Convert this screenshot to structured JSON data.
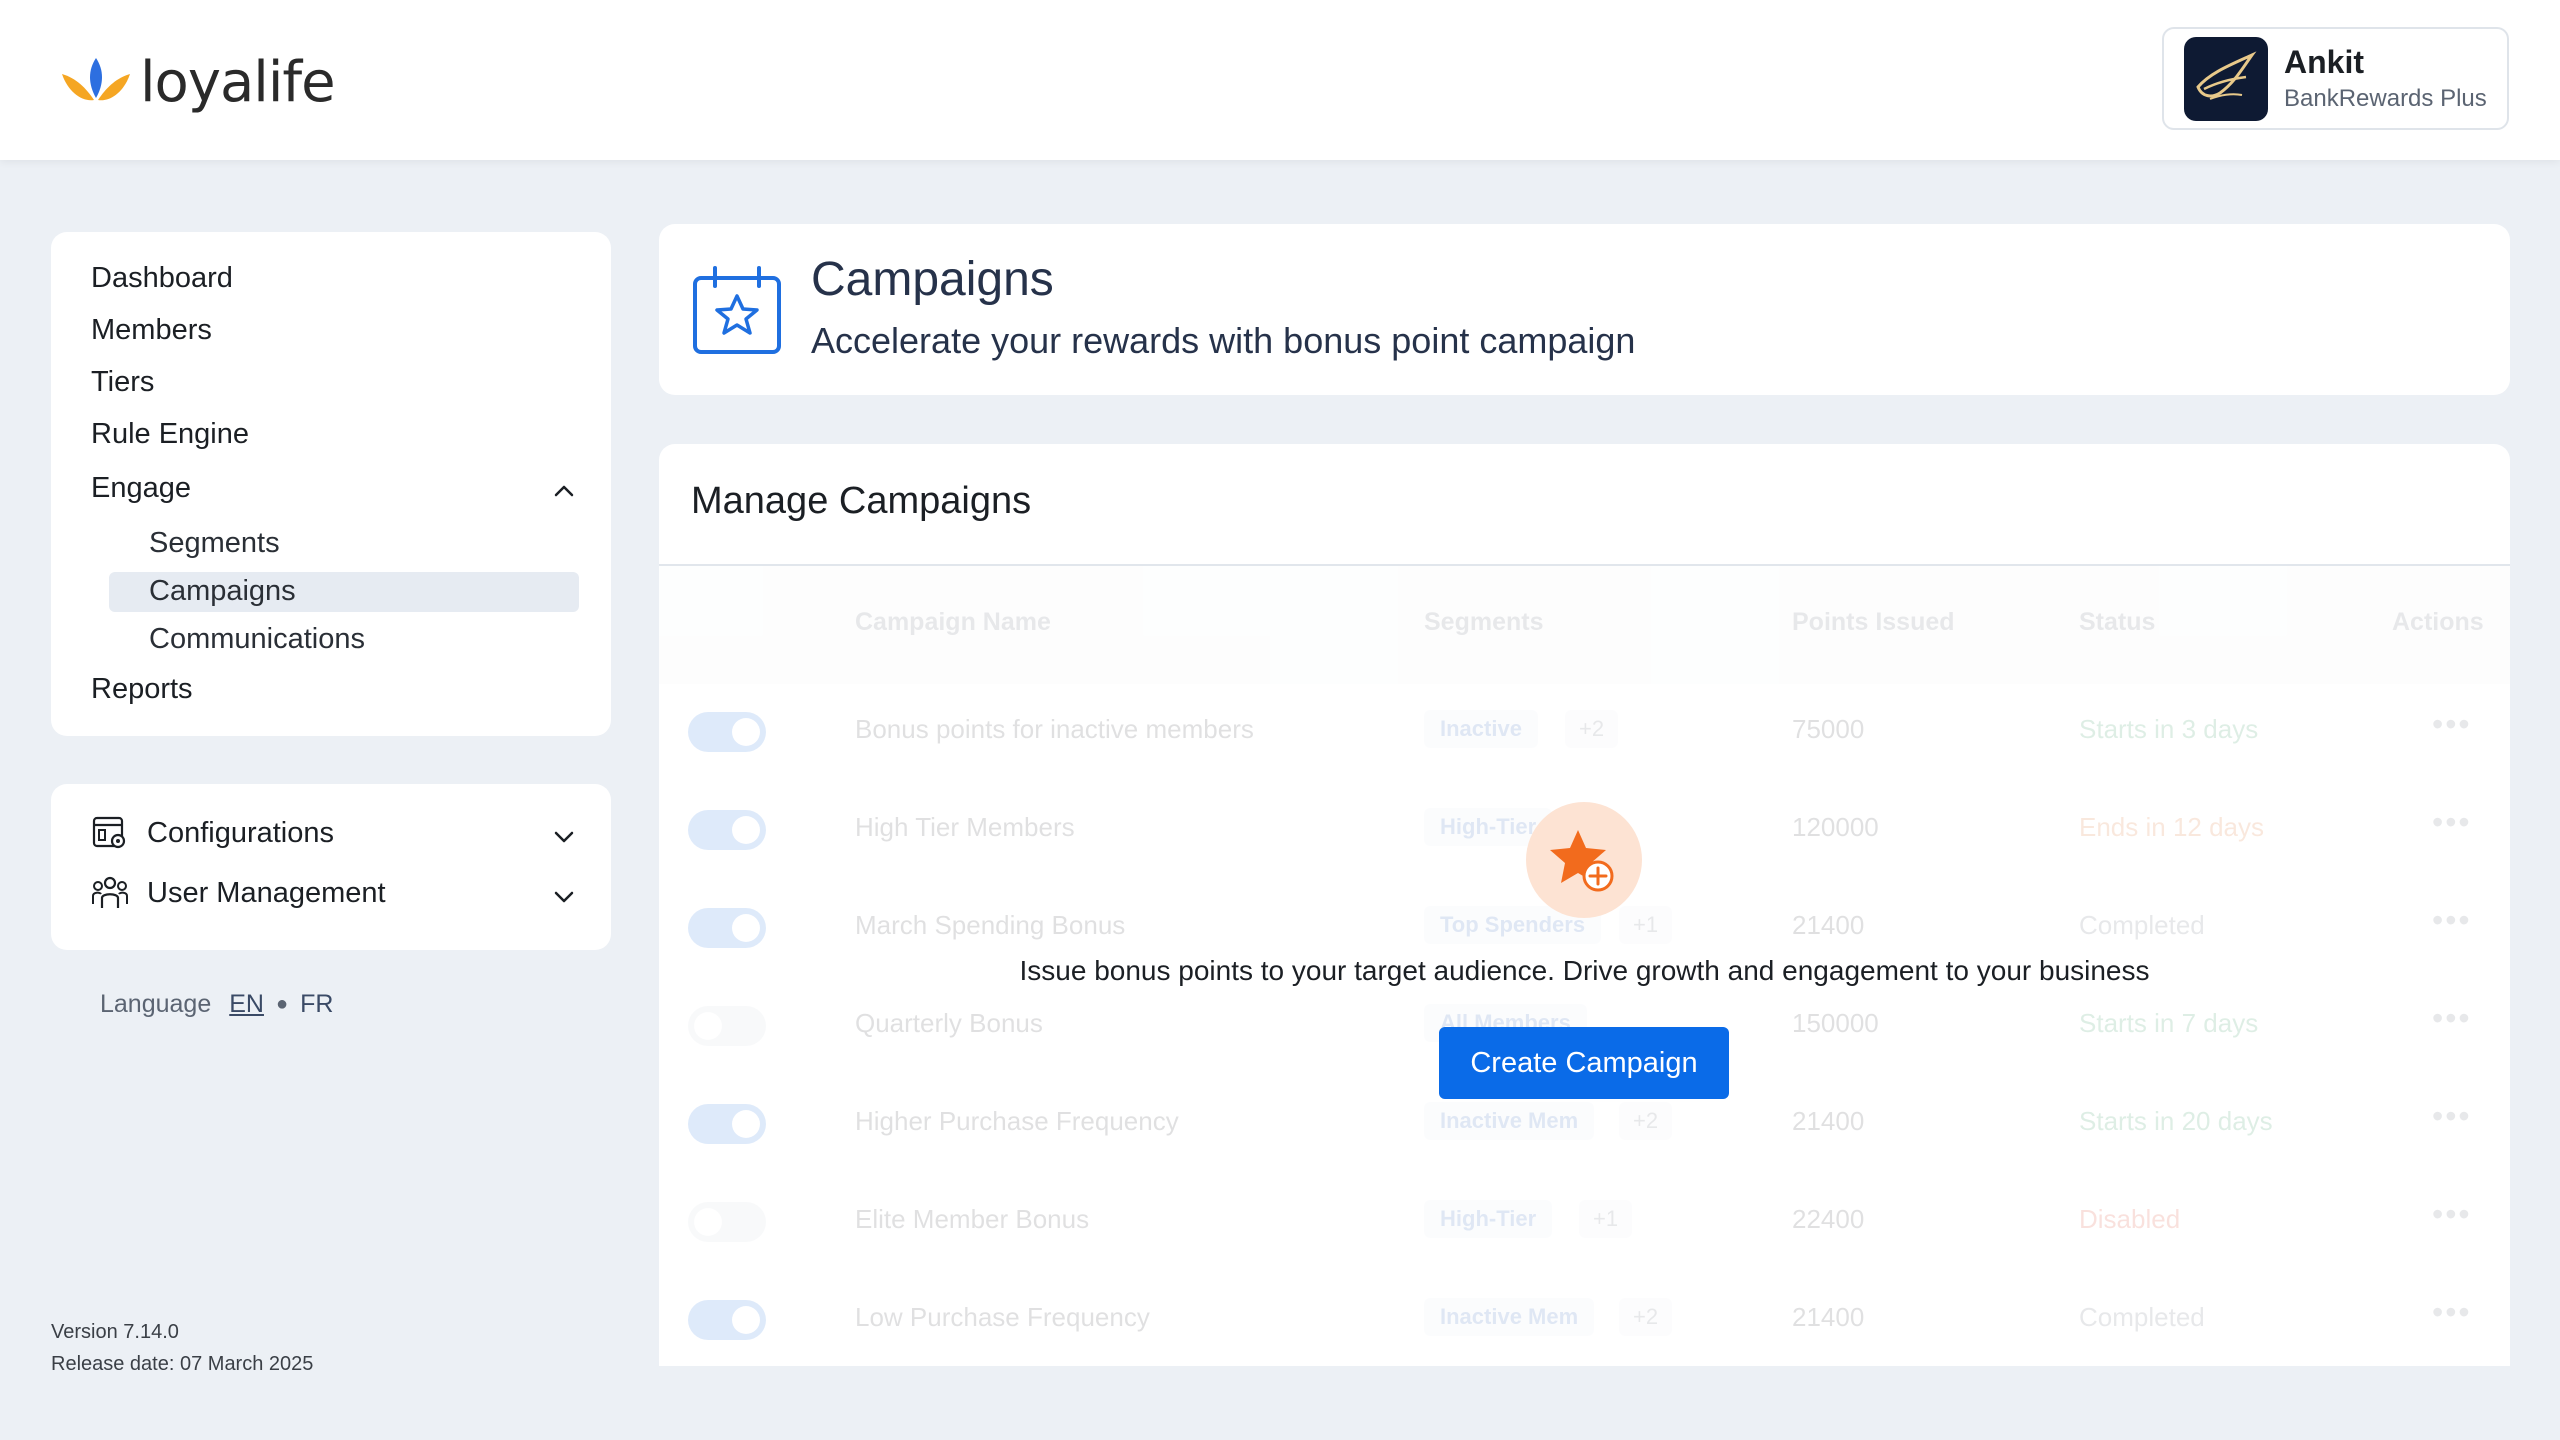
{
  "header": {
    "brand": "loyalife",
    "user": {
      "name": "Ankit",
      "org": "BankRewards Plus"
    }
  },
  "sidebar": {
    "items": [
      {
        "label": "Dashboard"
      },
      {
        "label": "Members"
      },
      {
        "label": "Tiers"
      },
      {
        "label": "Rule Engine"
      },
      {
        "label": "Engage"
      },
      {
        "label": "Reports"
      }
    ],
    "engage_sub": [
      {
        "label": "Segments"
      },
      {
        "label": "Campaigns",
        "active": true
      },
      {
        "label": "Communications"
      }
    ],
    "config": [
      {
        "label": "Configurations"
      },
      {
        "label": "User Management"
      }
    ],
    "language": {
      "label": "Language",
      "en": "EN",
      "fr": "FR"
    },
    "version": "Version 7.14.0",
    "release": "Release date: 07 March 2025"
  },
  "page": {
    "title": "Campaigns",
    "subtitle": "Accelerate your rewards with bonus point campaign"
  },
  "manage": {
    "title": "Manage Campaigns",
    "columns": [
      "Campaign Name",
      "Segments",
      "Points Issued",
      "Status",
      "Actions"
    ],
    "rows": [
      {
        "enabled": true,
        "name": "Bonus points for inactive members",
        "segment": "Inactive",
        "more": "+2",
        "points": "75000",
        "status": "Starts in 3 days"
      },
      {
        "enabled": true,
        "name": "High Tier Members",
        "segment": "High-Tier",
        "more": "",
        "points": "120000",
        "status": "Ends in 12 days"
      },
      {
        "enabled": true,
        "name": "March Spending Bonus",
        "segment": "Top Spenders",
        "more": "+1",
        "points": "21400",
        "status": "Completed"
      },
      {
        "enabled": false,
        "name": "Quarterly Bonus",
        "segment": "All Members",
        "more": "",
        "points": "150000",
        "status": "Starts in 7 days"
      },
      {
        "enabled": true,
        "name": "Higher Purchase Frequency",
        "segment": "Inactive Mem",
        "more": "+2",
        "points": "21400",
        "status": "Starts in 20 days"
      },
      {
        "enabled": false,
        "name": "Elite Member Bonus",
        "segment": "High-Tier",
        "more": "+1",
        "points": "22400",
        "status": "Disabled"
      },
      {
        "enabled": true,
        "name": "Low Purchase Frequency",
        "segment": "Inactive Mem",
        "more": "+2",
        "points": "21400",
        "status": "Completed"
      }
    ],
    "actions_glyph": "•••"
  },
  "empty_state": {
    "message": "Issue bonus points to your target audience. Drive growth and engagement to your business",
    "button": "Create Campaign"
  },
  "colors": {
    "primary": "#0a6be8",
    "accent_orange": "#f26b1d",
    "background": "#ecf0f5"
  }
}
